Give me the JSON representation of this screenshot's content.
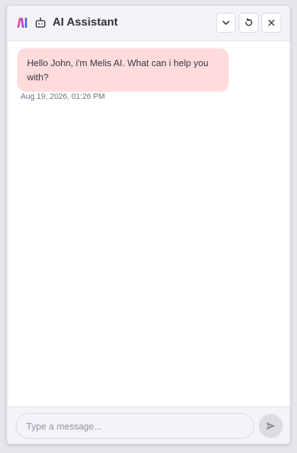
{
  "header": {
    "title": "AI Assistant",
    "logo_icon": "melis-logo-icon",
    "assistant_icon": "robot-icon",
    "actions": {
      "minimize_icon": "chevron-down-icon",
      "reset_icon": "refresh-icon",
      "close_icon": "close-icon"
    }
  },
  "chat": {
    "messages": [
      {
        "text": "Hello John, i'm Melis AI. What can i help you with?",
        "timestamp": "Aug 19, 2026, 01:26 PM",
        "sender": "assistant"
      }
    ]
  },
  "composer": {
    "placeholder": "Type a message...",
    "value": "",
    "send_icon": "send-icon"
  },
  "colors": {
    "bubble": "#ffdcdc",
    "accent_pink": "#e94b9c",
    "accent_purple": "#7b4de8"
  }
}
